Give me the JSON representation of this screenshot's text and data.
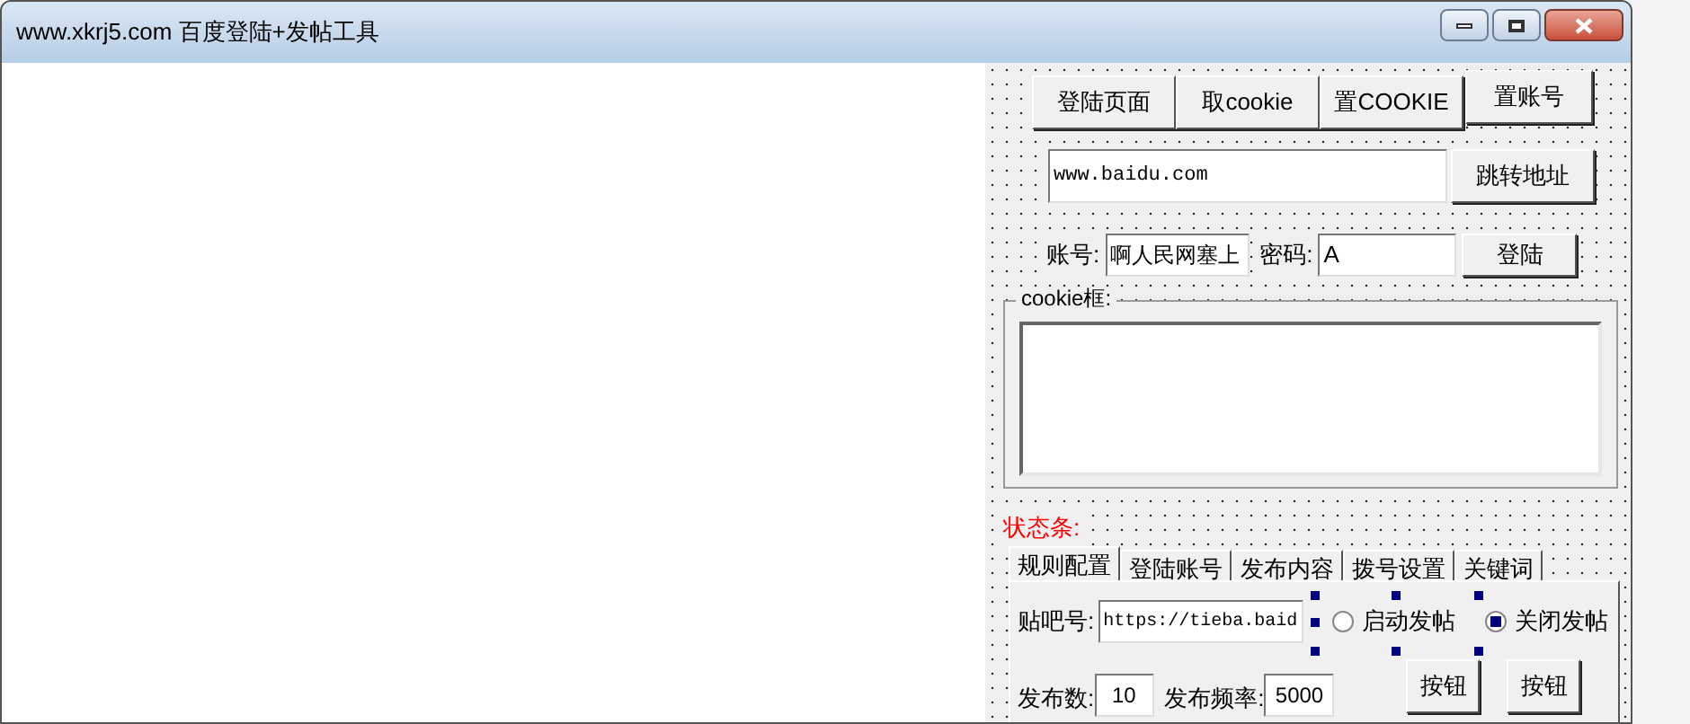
{
  "window": {
    "title": "www.xkrj5.com 百度登陆+发帖工具"
  },
  "toolbar_buttons": [
    "登陆页面",
    "取cookie",
    "置COOKIE",
    "置账号"
  ],
  "url": {
    "value": "www.baidu.com",
    "button": "跳转地址"
  },
  "login": {
    "account_label": "账号:",
    "account_value": "啊人民网塞上",
    "password_label": "密码:",
    "password_value": "A",
    "button": "登陆"
  },
  "cookie_box": {
    "label": "cookie框:"
  },
  "status": {
    "label": "状态条:"
  },
  "tabs": [
    {
      "label": "规则配置",
      "selected": true
    },
    {
      "label": "登陆账号",
      "selected": false
    },
    {
      "label": "发布内容",
      "selected": false
    },
    {
      "label": "拨号设置",
      "selected": false
    },
    {
      "label": "关键词",
      "selected": false
    }
  ],
  "config": {
    "tieba_label": "贴吧号:",
    "tieba_value": "https://tieba.baid",
    "radios": [
      {
        "label": "启动发帖",
        "selected": false
      },
      {
        "label": "关闭发帖",
        "selected": true
      }
    ],
    "count_label": "发布数:",
    "count_value": "10",
    "freq_label": "发布频率:",
    "freq_value": "5000",
    "buttons": [
      "按钮",
      "按钮"
    ]
  }
}
